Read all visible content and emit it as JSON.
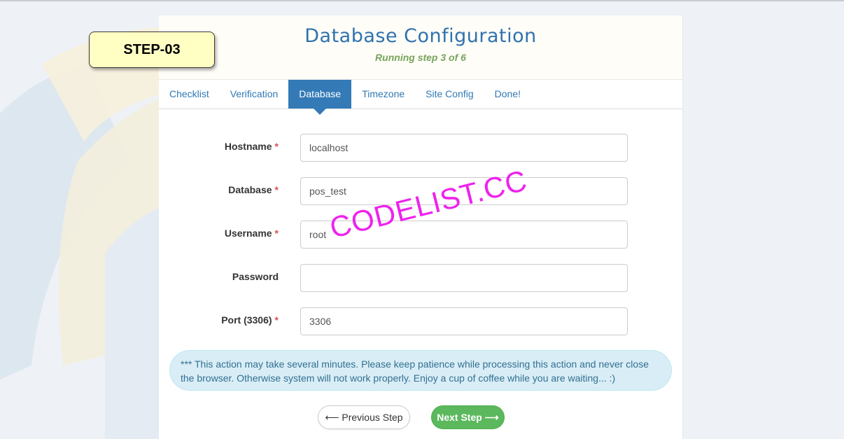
{
  "step_badge": "STEP-03",
  "header": {
    "title": "Database Configuration",
    "subtitle": "Running step 3 of 6"
  },
  "tabs": [
    {
      "label": "Checklist",
      "active": false
    },
    {
      "label": "Verification",
      "active": false
    },
    {
      "label": "Database",
      "active": true
    },
    {
      "label": "Timezone",
      "active": false
    },
    {
      "label": "Site Config",
      "active": false
    },
    {
      "label": "Done!",
      "active": false
    }
  ],
  "form": {
    "hostname": {
      "label": "Hostname",
      "required": "*",
      "value": "localhost"
    },
    "database": {
      "label": "Database",
      "required": "*",
      "value": "pos_test"
    },
    "username": {
      "label": "Username",
      "required": "*",
      "value": "root"
    },
    "password": {
      "label": "Password",
      "value": ""
    },
    "port": {
      "label": "Port (3306)",
      "required": "*",
      "value": "3306"
    }
  },
  "alert": "*** This action may take several minutes. Please keep patience while processing this action and never close the browser. Otherwise system will not work properly. Enjoy a cup of coffee while you are waiting... :)",
  "buttons": {
    "previous": "⟵ Previous Step",
    "next": "Next Step ⟶"
  },
  "watermark": "CODELIST.CC",
  "colors": {
    "accent": "#337ab7",
    "success": "#5cb85c",
    "required": "#d9534f",
    "subtitle": "#76a45a",
    "badge_bg": "#ffffc4"
  }
}
